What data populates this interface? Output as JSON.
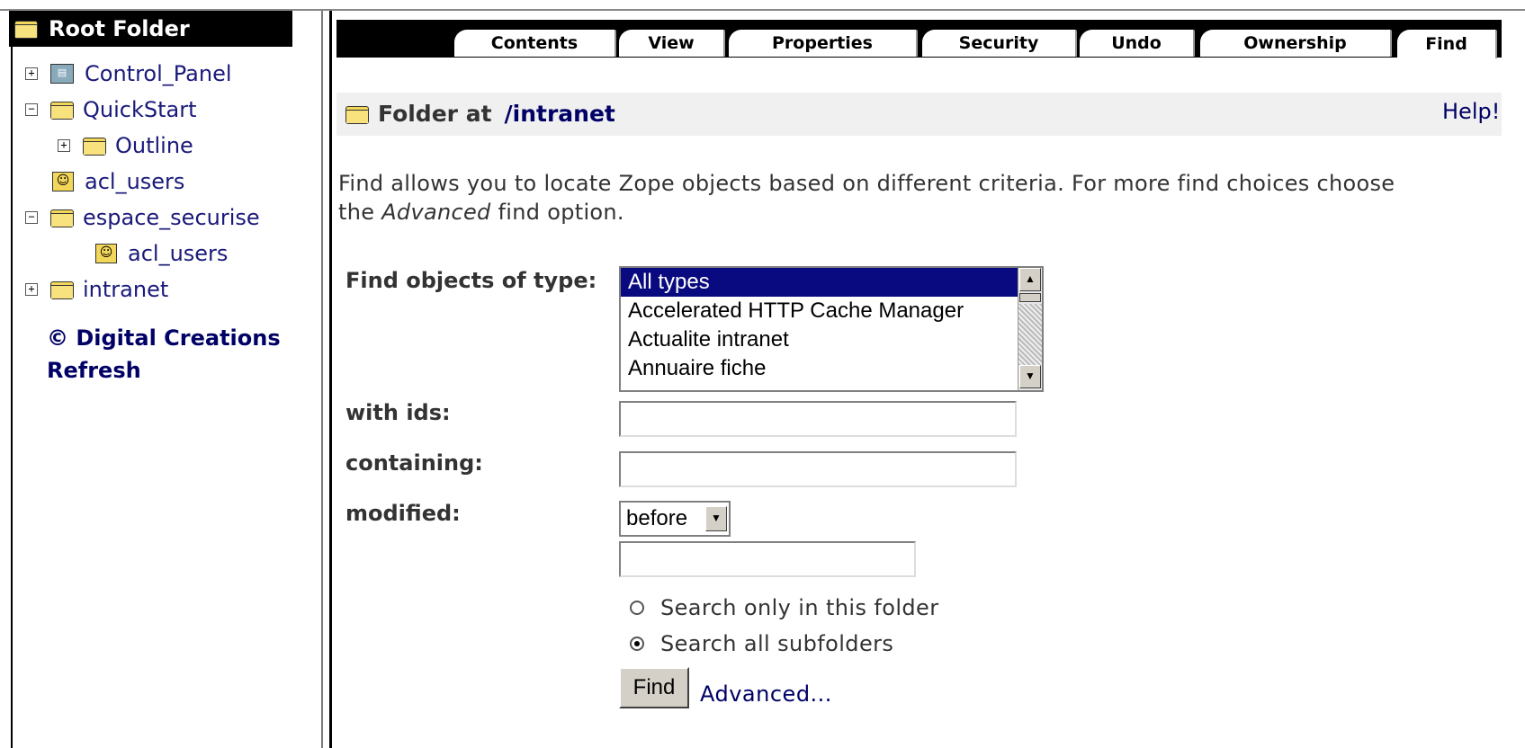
{
  "tree": {
    "root_label": "Root Folder",
    "items": [
      {
        "label": "Control_Panel",
        "expander": "+"
      },
      {
        "label": "QuickStart",
        "expander": "−"
      },
      {
        "label": "Outline",
        "expander": "+"
      },
      {
        "label": "acl_users",
        "expander": ""
      },
      {
        "label": "espace_securise",
        "expander": "−"
      },
      {
        "label": "acl_users",
        "expander": ""
      },
      {
        "label": "intranet",
        "expander": "+"
      }
    ],
    "copyright_link": "© Digital Creations",
    "refresh_link": "Refresh"
  },
  "tabs": [
    "Contents",
    "View",
    "Properties",
    "Security",
    "Undo",
    "Ownership",
    "Find"
  ],
  "active_tab": "Find",
  "header": {
    "prefix": "Folder at",
    "path": "/intranet",
    "help": "Help!"
  },
  "intro": {
    "line1": "Find allows you to locate Zope objects based on different criteria. For more find choices choose",
    "line2_pre": "the ",
    "line2_em": "Advanced",
    "line2_post": " find option."
  },
  "form": {
    "type_label": "Find objects of type:",
    "type_options": [
      "All types",
      "Accelerated HTTP Cache Manager",
      "Actualite intranet",
      "Annuaire fiche"
    ],
    "ids_label": "with ids:",
    "ids_value": "",
    "containing_label": "containing:",
    "containing_value": "",
    "modified_label": "modified:",
    "modified_select": "before",
    "modified_value": "",
    "radio_folder": "Search only in this folder",
    "radio_subfolders": "Search all subfolders",
    "radio_selected": "subfolders",
    "find_button": "Find",
    "advanced_link": "Advanced..."
  },
  "icons": {
    "folder": "folder-icon",
    "user_folder": "user-folder-icon",
    "control_panel": "control-panel-icon"
  },
  "colors": {
    "link": "#000066",
    "selected_option": "#0a0a80",
    "folder": "#f2d75a"
  }
}
